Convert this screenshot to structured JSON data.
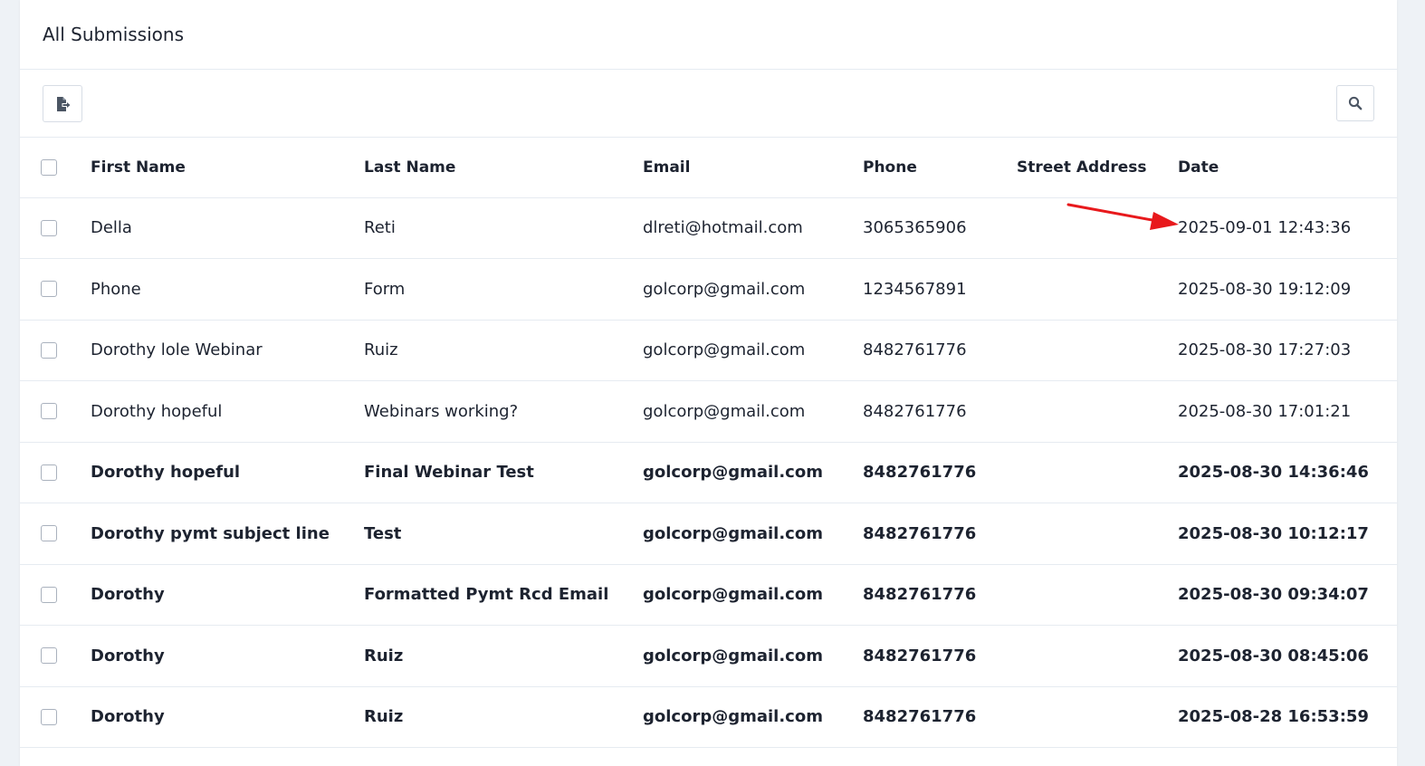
{
  "card": {
    "title": "All Submissions"
  },
  "toolbar": {
    "export_icon": "export-document-icon",
    "search_icon": "search-icon"
  },
  "table": {
    "headers": {
      "first_name": "First Name",
      "last_name": "Last Name",
      "email": "Email",
      "phone": "Phone",
      "street_address": "Street Address",
      "date": "Date"
    },
    "rows": [
      {
        "first_name": "Della",
        "last_name": "Reti",
        "email": "dlreti@hotmail.com",
        "phone": "3065365906",
        "street_address": "",
        "date": "2025-09-01 12:43:36",
        "unread": false
      },
      {
        "first_name": "Phone",
        "last_name": "Form",
        "email": "golcorp@gmail.com",
        "phone": "1234567891",
        "street_address": "",
        "date": "2025-08-30 19:12:09",
        "unread": false
      },
      {
        "first_name": "Dorothy lole Webinar",
        "last_name": "Ruiz",
        "email": "golcorp@gmail.com",
        "phone": "8482761776",
        "street_address": "",
        "date": "2025-08-30 17:27:03",
        "unread": false
      },
      {
        "first_name": "Dorothy hopeful",
        "last_name": "Webinars working?",
        "email": "golcorp@gmail.com",
        "phone": "8482761776",
        "street_address": "",
        "date": "2025-08-30 17:01:21",
        "unread": false
      },
      {
        "first_name": "Dorothy hopeful",
        "last_name": "Final Webinar Test",
        "email": "golcorp@gmail.com",
        "phone": "8482761776",
        "street_address": "",
        "date": "2025-08-30 14:36:46",
        "unread": true
      },
      {
        "first_name": "Dorothy pymt subject line",
        "last_name": "Test",
        "email": "golcorp@gmail.com",
        "phone": "8482761776",
        "street_address": "",
        "date": "2025-08-30 10:12:17",
        "unread": true
      },
      {
        "first_name": "Dorothy",
        "last_name": "Formatted Pymt Rcd Email",
        "email": "golcorp@gmail.com",
        "phone": "8482761776",
        "street_address": "",
        "date": "2025-08-30 09:34:07",
        "unread": true
      },
      {
        "first_name": "Dorothy",
        "last_name": "Ruiz",
        "email": "golcorp@gmail.com",
        "phone": "8482761776",
        "street_address": "",
        "date": "2025-08-30 08:45:06",
        "unread": true
      },
      {
        "first_name": "Dorothy",
        "last_name": "Ruiz",
        "email": "golcorp@gmail.com",
        "phone": "8482761776",
        "street_address": "",
        "date": "2025-08-28 16:53:59",
        "unread": true
      }
    ]
  },
  "colors": {
    "page_bg": "#eef2f6",
    "card_bg": "#ffffff",
    "border": "#e6ebf1",
    "text": "#1d2330",
    "annotation_arrow": "#e8191c"
  }
}
